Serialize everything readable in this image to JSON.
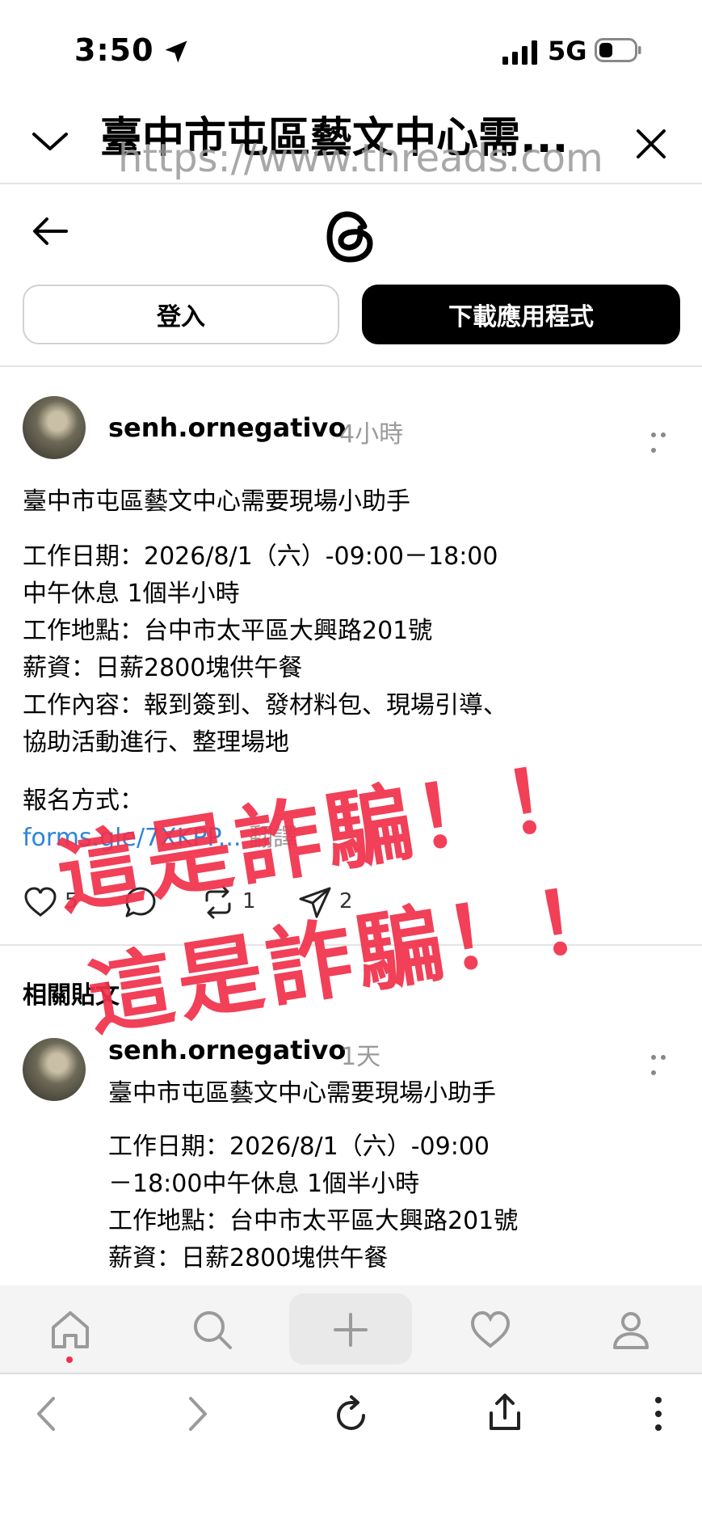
{
  "status_bar": {
    "time": "3:50",
    "network": "5G"
  },
  "browser_header": {
    "title": "臺中市屯區藝文中心需...",
    "url": "https://www.threads.com"
  },
  "threads_bar": {
    "login_label": "登入",
    "download_app_label": "下載應用程式"
  },
  "post": {
    "username": "senh.ornegativo",
    "time_ago": "4小時",
    "lines": [
      "臺中市屯區藝文中心需要現場小助手",
      "工作日期：2026/8/1（六）-09:00－18:00",
      "中午休息 1個半小時",
      "工作地點：台中市太平區大興路201號",
      "薪資：日薪2800塊供午餐",
      "工作內容：報到簽到、發材料包、現場引導、",
      "協助活動進行、整理場地",
      "報名方式："
    ],
    "link_text": "forms.gle/7XKPP...",
    "translate_label": "翻譯",
    "likes": "5",
    "reposts": "1",
    "shares": "2"
  },
  "related": {
    "title": "相關貼文",
    "post": {
      "username": "senh.ornegativo",
      "time_ago": "1天",
      "lines": [
        "臺中市屯區藝文中心需要現場小助手",
        "工作日期：2026/8/1（六）-09:00",
        "－18:00中午休息 1個半小時",
        "工作地點：台中市太平區大興路201號",
        "薪資：日薪2800塊供午餐"
      ]
    }
  },
  "overlay": {
    "line1": "這是詐騙！！",
    "line2": "這是詐騙！！",
    "color": "#f0304a"
  },
  "tab_bar": {
    "icons": [
      "home-icon",
      "search-icon",
      "plus-icon",
      "heart-icon",
      "profile-icon"
    ]
  },
  "browser_toolbar": {
    "icons": [
      "back-icon",
      "forward-icon",
      "reload-icon",
      "share-icon",
      "more-icon"
    ]
  }
}
